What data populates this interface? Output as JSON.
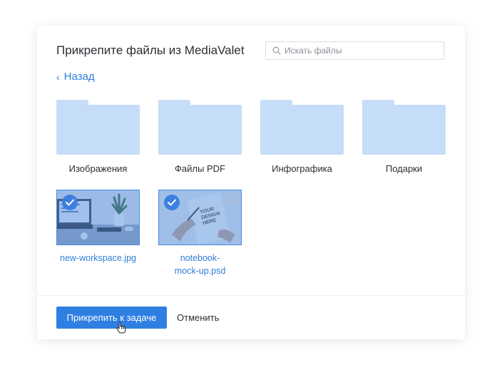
{
  "dialog": {
    "title": "Прикрепите файлы из MediaValet",
    "search": {
      "placeholder": "Искать файлы",
      "value": "",
      "icon": "search-icon"
    },
    "back": {
      "label": "Назад",
      "icon": "chevron-left-icon"
    },
    "folders": [
      {
        "label": "Изображения"
      },
      {
        "label": "Файлы PDF"
      },
      {
        "label": "Инфографика"
      },
      {
        "label": "Подарки"
      }
    ],
    "files": [
      {
        "name": "new-workspace.jpg",
        "selected": true,
        "icon": "checkmark-icon"
      },
      {
        "name": "notebook-\nmock-up.psd",
        "selected": true,
        "icon": "checkmark-icon"
      }
    ],
    "footer": {
      "attach_label": "Прикрепить к задаче",
      "cancel_label": "Отменить"
    }
  },
  "colors": {
    "accent": "#2f7fe3",
    "link": "#2d7fd9",
    "folder": "#c6ddf9",
    "selected_tint": "#4a8ae3"
  }
}
